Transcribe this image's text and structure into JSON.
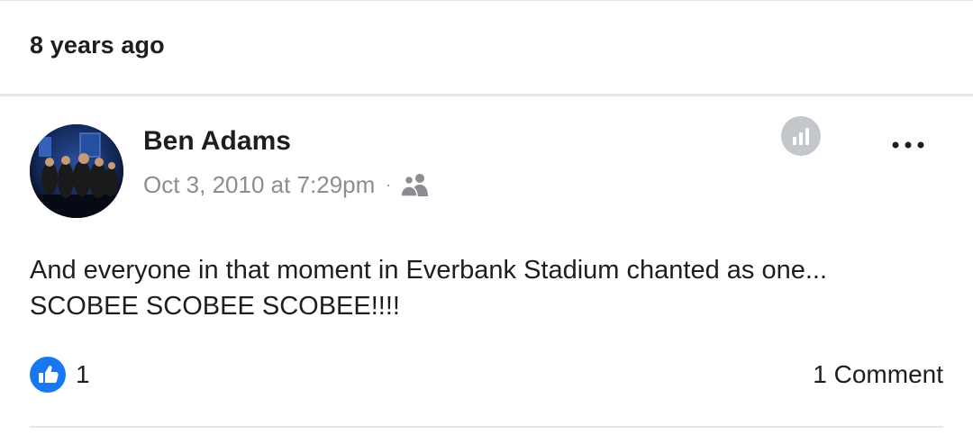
{
  "memory": {
    "label": "8 years ago"
  },
  "post": {
    "author": "Ben Adams",
    "timestamp": "Oct 3, 2010 at 7:29pm",
    "separator": "·",
    "audience_icon": "friends-icon",
    "text_lines": [
      "And everyone in that moment in Everbank Stadium chanted as one...",
      "SCOBEE SCOBEE SCOBEE!!!!"
    ],
    "reactions": {
      "icon": "like-icon",
      "count": "1"
    },
    "comments": "1 Comment"
  },
  "icons": {
    "insights": "insights-icon",
    "more": "more-options-icon"
  },
  "colors": {
    "like_blue": "#1877f2",
    "meta_gray": "#8a8d91",
    "insights_gray": "#c3c6ca",
    "divider": "#e4e6eb",
    "text": "#1c1e21"
  }
}
